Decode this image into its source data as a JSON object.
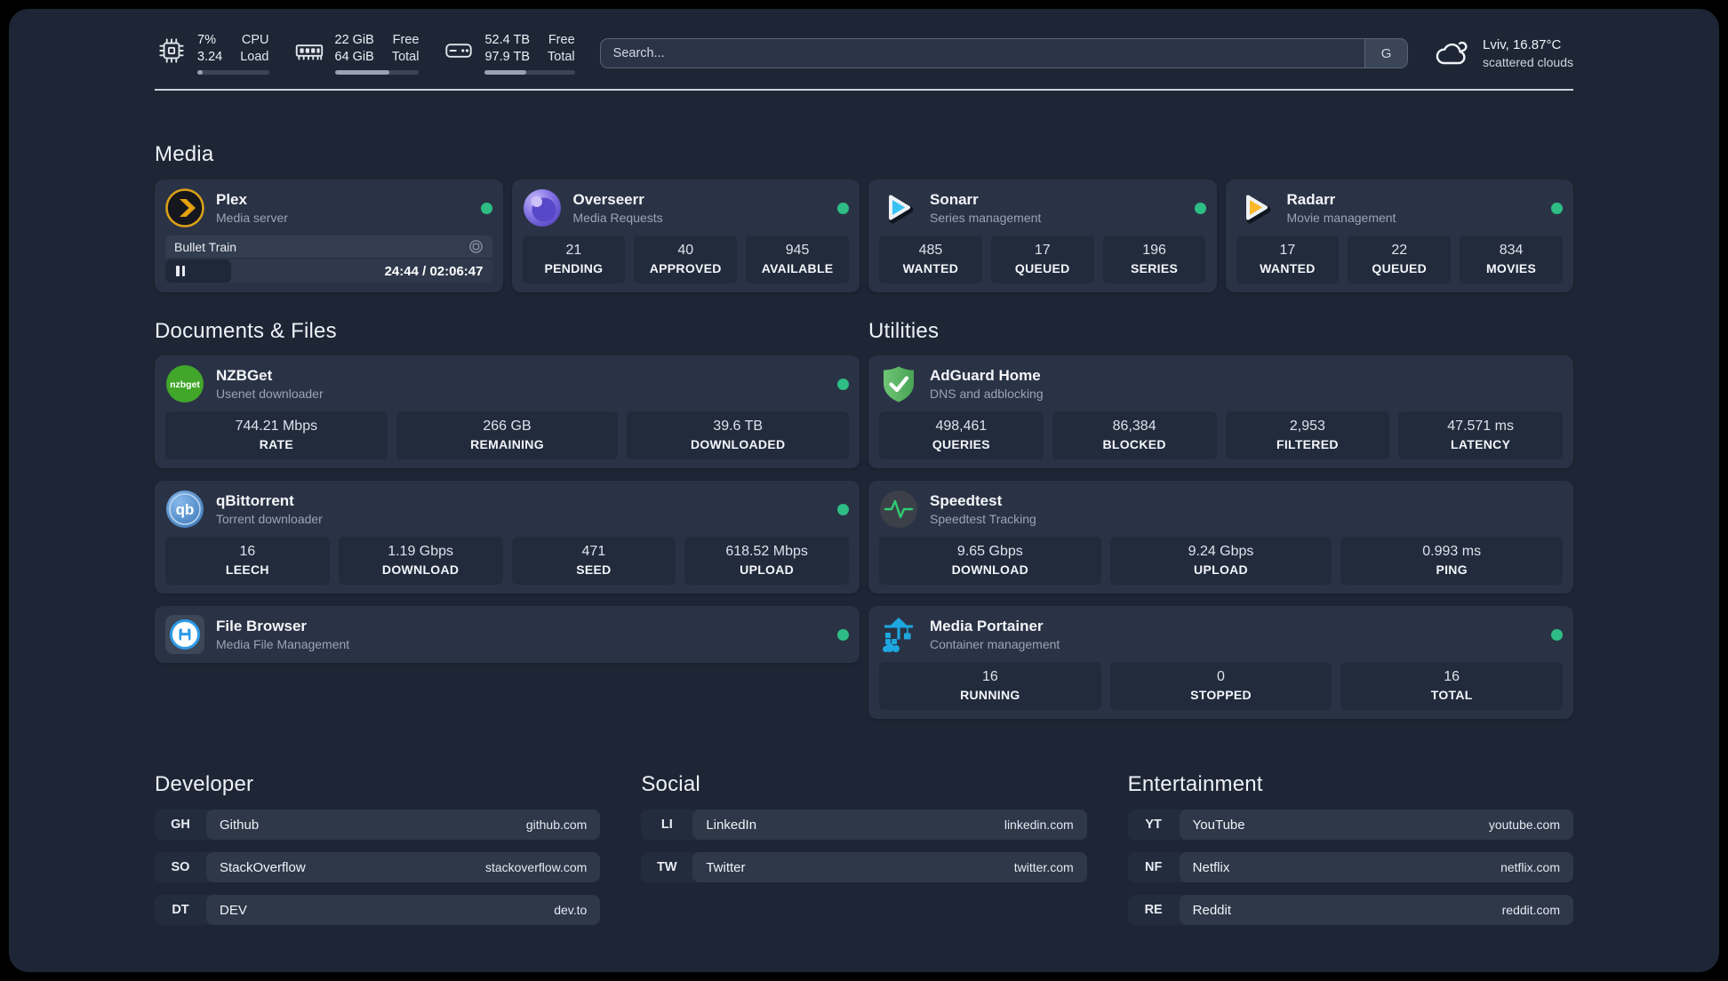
{
  "header": {
    "widgets": [
      {
        "name": "CPU",
        "icon": "cpu-icon",
        "rows": [
          {
            "value": "7%",
            "label": "CPU"
          },
          {
            "value": "3.24",
            "label": "Load"
          }
        ],
        "progress": 7
      },
      {
        "name": "Memory",
        "icon": "memory-icon",
        "rows": [
          {
            "value": "22 GiB",
            "label": "Free"
          },
          {
            "value": "64 GiB",
            "label": "Total"
          }
        ],
        "progress": 65
      },
      {
        "name": "Storage",
        "icon": "hard-drive-icon",
        "rows": [
          {
            "value": "52.4 TB",
            "label": "Free"
          },
          {
            "value": "97.9 TB",
            "label": "Total"
          }
        ],
        "progress": 46
      }
    ],
    "search": {
      "placeholder": "Search...",
      "engine_label": "G"
    },
    "weather": {
      "location": "Lviv, 16.87°C",
      "condition": "scattered clouds"
    }
  },
  "media": {
    "title": "Media",
    "plex": {
      "name": "Plex",
      "description": "Media server",
      "online": true,
      "now_playing": {
        "title": "Bullet Train",
        "state": "paused",
        "time_display": "24:44 / 02:06:47",
        "progress": 20
      }
    },
    "overseerr": {
      "name": "Overseerr",
      "description": "Media Requests",
      "online": true,
      "stats": [
        {
          "value": "21",
          "label": "PENDING"
        },
        {
          "value": "40",
          "label": "APPROVED"
        },
        {
          "value": "945",
          "label": "AVAILABLE"
        }
      ]
    },
    "sonarr": {
      "name": "Sonarr",
      "description": "Series management",
      "online": true,
      "stats": [
        {
          "value": "485",
          "label": "WANTED"
        },
        {
          "value": "17",
          "label": "QUEUED"
        },
        {
          "value": "196",
          "label": "SERIES"
        }
      ]
    },
    "radarr": {
      "name": "Radarr",
      "description": "Movie management",
      "online": true,
      "stats": [
        {
          "value": "17",
          "label": "WANTED"
        },
        {
          "value": "22",
          "label": "QUEUED"
        },
        {
          "value": "834",
          "label": "MOVIES"
        }
      ]
    }
  },
  "documents": {
    "title": "Documents & Files",
    "nzbget": {
      "name": "NZBGet",
      "description": "Usenet downloader",
      "online": true,
      "stats": [
        {
          "value": "744.21 Mbps",
          "label": "RATE"
        },
        {
          "value": "266 GB",
          "label": "REMAINING"
        },
        {
          "value": "39.6 TB",
          "label": "DOWNLOADED"
        }
      ]
    },
    "qbittorrent": {
      "name": "qBittorrent",
      "description": "Torrent downloader",
      "online": true,
      "stats": [
        {
          "value": "16",
          "label": "LEECH"
        },
        {
          "value": "1.19 Gbps",
          "label": "DOWNLOAD"
        },
        {
          "value": "471",
          "label": "SEED"
        },
        {
          "value": "618.52 Mbps",
          "label": "UPLOAD"
        }
      ]
    },
    "filebrowser": {
      "name": "File Browser",
      "description": "Media File Management",
      "online": true
    }
  },
  "utilities": {
    "title": "Utilities",
    "adguard": {
      "name": "AdGuard Home",
      "description": "DNS and adblocking",
      "stats": [
        {
          "value": "498,461",
          "label": "QUERIES"
        },
        {
          "value": "86,384",
          "label": "BLOCKED"
        },
        {
          "value": "2,953",
          "label": "FILTERED"
        },
        {
          "value": "47.571 ms",
          "label": "LATENCY"
        }
      ]
    },
    "speedtest": {
      "name": "Speedtest",
      "description": "Speedtest Tracking",
      "stats": [
        {
          "value": "9.65 Gbps",
          "label": "DOWNLOAD"
        },
        {
          "value": "9.24 Gbps",
          "label": "UPLOAD"
        },
        {
          "value": "0.993 ms",
          "label": "PING"
        }
      ]
    },
    "portainer": {
      "name": "Media Portainer",
      "description": "Container management",
      "online": true,
      "stats": [
        {
          "value": "16",
          "label": "RUNNING"
        },
        {
          "value": "0",
          "label": "STOPPED"
        },
        {
          "value": "16",
          "label": "TOTAL"
        }
      ]
    }
  },
  "bookmarks": {
    "developer": {
      "title": "Developer",
      "items": [
        {
          "abbr": "GH",
          "name": "Github",
          "domain": "github.com"
        },
        {
          "abbr": "SO",
          "name": "StackOverflow",
          "domain": "stackoverflow.com"
        },
        {
          "abbr": "DT",
          "name": "DEV",
          "domain": "dev.to"
        }
      ]
    },
    "social": {
      "title": "Social",
      "items": [
        {
          "abbr": "LI",
          "name": "LinkedIn",
          "domain": "linkedin.com"
        },
        {
          "abbr": "TW",
          "name": "Twitter",
          "domain": "twitter.com"
        }
      ]
    },
    "entertainment": {
      "title": "Entertainment",
      "items": [
        {
          "abbr": "YT",
          "name": "YouTube",
          "domain": "youtube.com"
        },
        {
          "abbr": "NF",
          "name": "Netflix",
          "domain": "netflix.com"
        },
        {
          "abbr": "RE",
          "name": "Reddit",
          "domain": "reddit.com"
        }
      ]
    }
  },
  "colors": {
    "background": "#1e2636",
    "card": "#2a3345",
    "tile": "#222b3c",
    "status_online": "#2ebd85"
  }
}
